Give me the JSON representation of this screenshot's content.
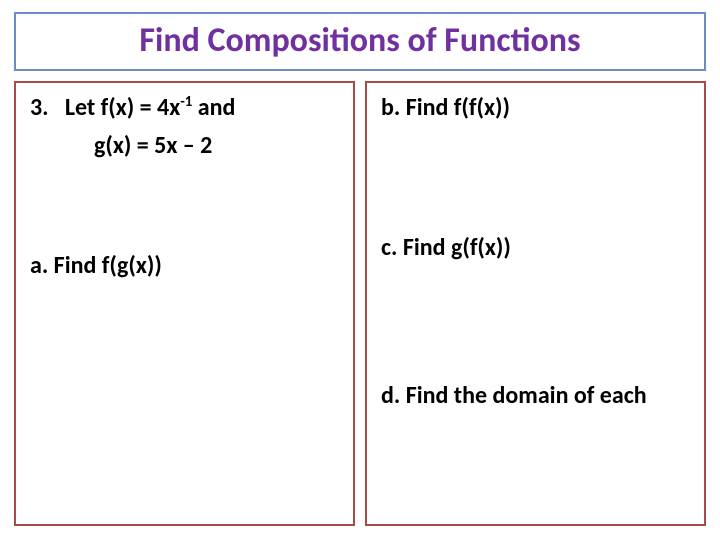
{
  "title": "Find Compositions of Functions",
  "left": {
    "problem_number": "3.",
    "let_prefix": "Let f(x) = 4x",
    "exponent": "-1",
    "let_suffix": " and",
    "g_def": "g(x) = 5x – 2",
    "part_a": "a.  Find f(g(x))"
  },
  "right": {
    "part_b": "b.  Find f(f(x))",
    "part_c": "c.    Find g(f(x))",
    "part_d": "d.   Find the domain of each"
  }
}
